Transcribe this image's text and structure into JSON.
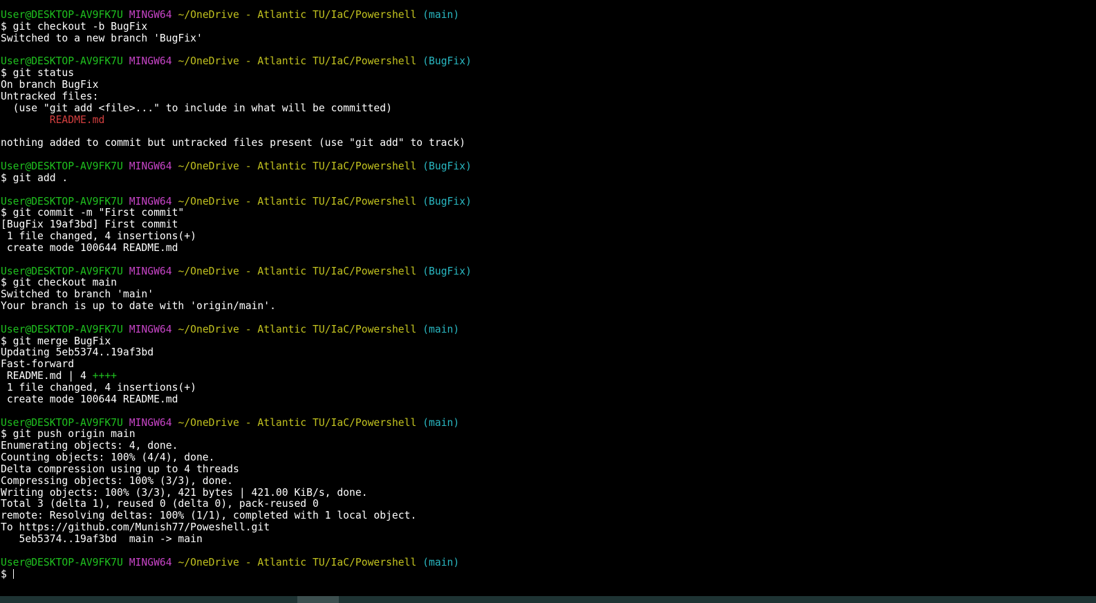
{
  "colors": {
    "background": "#000000",
    "user": "#1fc21f",
    "msystem": "#c644c6",
    "path": "#c2c21f",
    "branch": "#29b8c2",
    "untracked": "#d33f3f",
    "plus": "#1fc21f"
  },
  "lines": [
    [
      [
        "User@DESKTOP-AV9FK7U",
        "green"
      ],
      [
        " ",
        "plain"
      ],
      [
        "MINGW64",
        "purple"
      ],
      [
        " ",
        "plain"
      ],
      [
        "~/OneDrive - Atlantic TU/IaC/Powershell",
        "yellow"
      ],
      [
        " ",
        "plain"
      ],
      [
        "(main)",
        "cyan"
      ]
    ],
    [
      [
        "$ git checkout -b BugFix",
        "plain"
      ]
    ],
    [
      [
        "Switched to a new branch 'BugFix'",
        "plain"
      ]
    ],
    [],
    [
      [
        "User@DESKTOP-AV9FK7U",
        "green"
      ],
      [
        " ",
        "plain"
      ],
      [
        "MINGW64",
        "purple"
      ],
      [
        " ",
        "plain"
      ],
      [
        "~/OneDrive - Atlantic TU/IaC/Powershell",
        "yellow"
      ],
      [
        " ",
        "plain"
      ],
      [
        "(BugFix)",
        "cyan"
      ]
    ],
    [
      [
        "$ git status",
        "plain"
      ]
    ],
    [
      [
        "On branch BugFix",
        "plain"
      ]
    ],
    [
      [
        "Untracked files:",
        "plain"
      ]
    ],
    [
      [
        "  (use \"git add <file>...\" to include in what will be committed)",
        "plain"
      ]
    ],
    [
      [
        "        ",
        "plain"
      ],
      [
        "README.md",
        "red"
      ]
    ],
    [],
    [
      [
        "nothing added to commit but untracked files present (use \"git add\" to track)",
        "plain"
      ]
    ],
    [],
    [
      [
        "User@DESKTOP-AV9FK7U",
        "green"
      ],
      [
        " ",
        "plain"
      ],
      [
        "MINGW64",
        "purple"
      ],
      [
        " ",
        "plain"
      ],
      [
        "~/OneDrive - Atlantic TU/IaC/Powershell",
        "yellow"
      ],
      [
        " ",
        "plain"
      ],
      [
        "(BugFix)",
        "cyan"
      ]
    ],
    [
      [
        "$ git add .",
        "plain"
      ]
    ],
    [],
    [
      [
        "User@DESKTOP-AV9FK7U",
        "green"
      ],
      [
        " ",
        "plain"
      ],
      [
        "MINGW64",
        "purple"
      ],
      [
        " ",
        "plain"
      ],
      [
        "~/OneDrive - Atlantic TU/IaC/Powershell",
        "yellow"
      ],
      [
        " ",
        "plain"
      ],
      [
        "(BugFix)",
        "cyan"
      ]
    ],
    [
      [
        "$ git commit -m \"First commit\"",
        "plain"
      ]
    ],
    [
      [
        "[BugFix 19af3bd] First commit",
        "plain"
      ]
    ],
    [
      [
        " 1 file changed, 4 insertions(+)",
        "plain"
      ]
    ],
    [
      [
        " create mode 100644 README.md",
        "plain"
      ]
    ],
    [],
    [
      [
        "User@DESKTOP-AV9FK7U",
        "green"
      ],
      [
        " ",
        "plain"
      ],
      [
        "MINGW64",
        "purple"
      ],
      [
        " ",
        "plain"
      ],
      [
        "~/OneDrive - Atlantic TU/IaC/Powershell",
        "yellow"
      ],
      [
        " ",
        "plain"
      ],
      [
        "(BugFix)",
        "cyan"
      ]
    ],
    [
      [
        "$ git checkout main",
        "plain"
      ]
    ],
    [
      [
        "Switched to branch 'main'",
        "plain"
      ]
    ],
    [
      [
        "Your branch is up to date with 'origin/main'.",
        "plain"
      ]
    ],
    [],
    [
      [
        "User@DESKTOP-AV9FK7U",
        "green"
      ],
      [
        " ",
        "plain"
      ],
      [
        "MINGW64",
        "purple"
      ],
      [
        " ",
        "plain"
      ],
      [
        "~/OneDrive - Atlantic TU/IaC/Powershell",
        "yellow"
      ],
      [
        " ",
        "plain"
      ],
      [
        "(main)",
        "cyan"
      ]
    ],
    [
      [
        "$ git merge BugFix",
        "plain"
      ]
    ],
    [
      [
        "Updating 5eb5374..19af3bd",
        "plain"
      ]
    ],
    [
      [
        "Fast-forward",
        "plain"
      ]
    ],
    [
      [
        " README.md | 4 ",
        "plain"
      ],
      [
        "++++",
        "green"
      ]
    ],
    [
      [
        " 1 file changed, 4 insertions(+)",
        "plain"
      ]
    ],
    [
      [
        " create mode 100644 README.md",
        "plain"
      ]
    ],
    [],
    [
      [
        "User@DESKTOP-AV9FK7U",
        "green"
      ],
      [
        " ",
        "plain"
      ],
      [
        "MINGW64",
        "purple"
      ],
      [
        " ",
        "plain"
      ],
      [
        "~/OneDrive - Atlantic TU/IaC/Powershell",
        "yellow"
      ],
      [
        " ",
        "plain"
      ],
      [
        "(main)",
        "cyan"
      ]
    ],
    [
      [
        "$ git push origin main",
        "plain"
      ]
    ],
    [
      [
        "Enumerating objects: 4, done.",
        "plain"
      ]
    ],
    [
      [
        "Counting objects: 100% (4/4), done.",
        "plain"
      ]
    ],
    [
      [
        "Delta compression using up to 4 threads",
        "plain"
      ]
    ],
    [
      [
        "Compressing objects: 100% (3/3), done.",
        "plain"
      ]
    ],
    [
      [
        "Writing objects: 100% (3/3), 421 bytes | 421.00 KiB/s, done.",
        "plain"
      ]
    ],
    [
      [
        "Total 3 (delta 1), reused 0 (delta 0), pack-reused 0",
        "plain"
      ]
    ],
    [
      [
        "remote: Resolving deltas: 100% (1/1), completed with 1 local object.",
        "plain"
      ]
    ],
    [
      [
        "To https://github.com/Munish77/Poweshell.git",
        "plain"
      ]
    ],
    [
      [
        "   5eb5374..19af3bd  main -> main",
        "plain"
      ]
    ],
    [],
    [
      [
        "User@DESKTOP-AV9FK7U",
        "green"
      ],
      [
        " ",
        "plain"
      ],
      [
        "MINGW64",
        "purple"
      ],
      [
        " ",
        "plain"
      ],
      [
        "~/OneDrive - Atlantic TU/IaC/Powershell",
        "yellow"
      ],
      [
        " ",
        "plain"
      ],
      [
        "(main)",
        "cyan"
      ]
    ]
  ],
  "prompt": {
    "symbol": "$ ",
    "input_value": ""
  }
}
